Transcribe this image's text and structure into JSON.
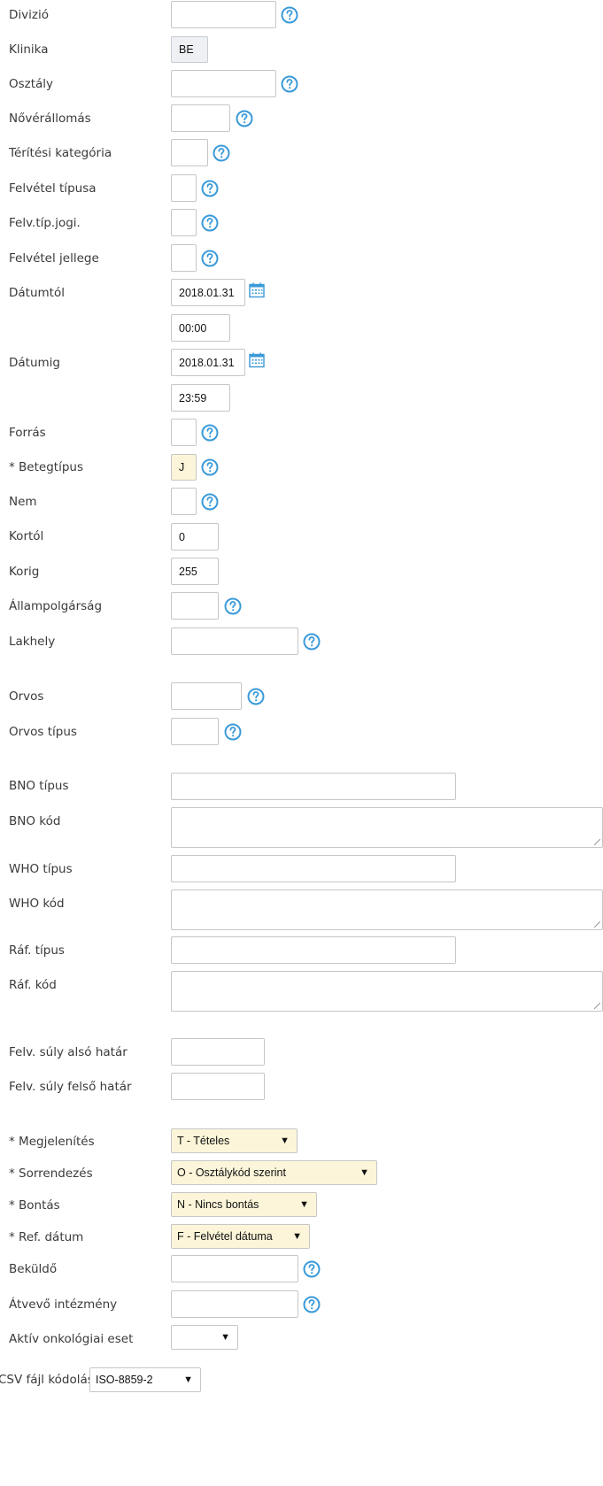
{
  "labels": {
    "divizio": "Divizió",
    "klinika": "Klinika",
    "osztaly": "Osztály",
    "novérallomas": "Nővérállomás",
    "teritesi": "Térítési kategória",
    "felvetel_tipusa": "Felvétel típusa",
    "felv_tip_jogi": "Felv.típ.jogi.",
    "felvetel_jellege": "Felvétel jellege",
    "datumtol": "Dátumtól",
    "datumig": "Dátumig",
    "forras": "Forrás",
    "betegtipus": "* Betegtípus",
    "nem": "Nem",
    "kortol": "Kortól",
    "korig": "Korig",
    "allampolgarsag": "Állampolgárság",
    "lakhely": "Lakhely",
    "orvos": "Orvos",
    "orvos_tipus": "Orvos típus",
    "bno_tipus": "BNO típus",
    "bno_kod": "BNO kód",
    "who_tipus": "WHO típus",
    "who_kod": "WHO kód",
    "raf_tipus": "Ráf. típus",
    "raf_kod": "Ráf. kód",
    "suly_also": "Felv. súly alsó határ",
    "suly_felso": "Felv. súly felső határ",
    "megjelenites": "* Megjelenítés",
    "sorrendezes": "* Sorrendezés",
    "bontas": "* Bontás",
    "ref_datum": "* Ref. dátum",
    "bekuldo": "Beküldő",
    "atvevo": "Átvevő intézmény",
    "onkologiai": "Aktív onkológiai eset",
    "csv": "CSV fájl kódolás"
  },
  "values": {
    "klinika": "BE",
    "datumtol_date": "2018.01.31",
    "datumtol_time": "00:00",
    "datumig_date": "2018.01.31",
    "datumig_time": "23:59",
    "betegtipus": "J",
    "kortol": "0",
    "korig": "255",
    "megjelenites": "T - Tételes",
    "sorrendezes": "O - Osztálykód szerint",
    "bontas": "N - Nincs bontás",
    "ref_datum": "F - Felvétel dátuma",
    "onkologiai": "",
    "csv": "ISO-8859-2"
  },
  "icons": {
    "help": "help-circle-icon",
    "calendar": "calendar-icon",
    "dropdown": "dropdown-arrow-icon"
  },
  "colors": {
    "accent": "#3a9ad9",
    "required_bg": "#fcf5d9",
    "readonly_bg": "#eef0f4"
  }
}
